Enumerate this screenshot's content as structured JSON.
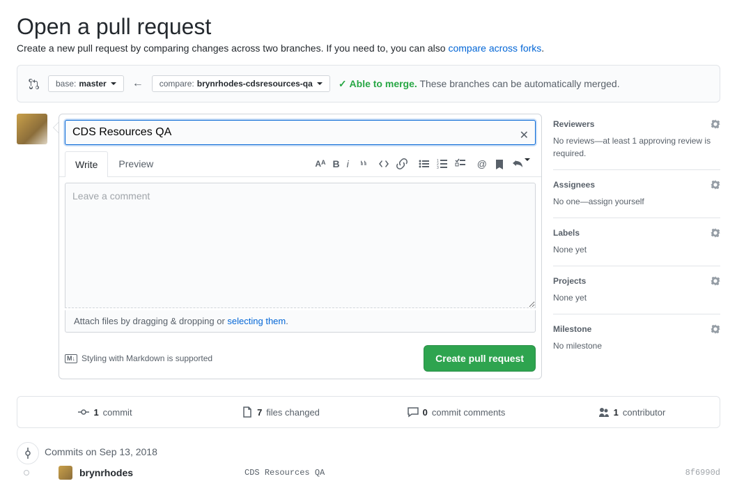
{
  "page": {
    "title": "Open a pull request",
    "subtitle_prefix": "Create a new pull request by comparing changes across two branches. If you need to, you can also ",
    "subtitle_link": "compare across forks",
    "subtitle_suffix": "."
  },
  "branches": {
    "base_label": "base:",
    "base_value": "master",
    "compare_label": "compare:",
    "compare_value": "brynrhodes-cdsresources-qa"
  },
  "merge": {
    "status": "Able to merge.",
    "description": "These branches can be automatically merged."
  },
  "pr": {
    "title_value": "CDS Resources QA",
    "comment_placeholder": "Leave a comment"
  },
  "tabs": {
    "write": "Write",
    "preview": "Preview"
  },
  "attach": {
    "prefix": "Attach files by dragging & dropping or ",
    "link": "selecting them",
    "suffix": "."
  },
  "footer": {
    "markdown_hint": "Styling with Markdown is supported",
    "create_label": "Create pull request"
  },
  "sidebar": {
    "reviewers": {
      "title": "Reviewers",
      "body": "No reviews—at least 1 approving review is required."
    },
    "assignees": {
      "title": "Assignees",
      "body_prefix": "No one—",
      "body_link": "assign yourself"
    },
    "labels": {
      "title": "Labels",
      "body": "None yet"
    },
    "projects": {
      "title": "Projects",
      "body": "None yet"
    },
    "milestone": {
      "title": "Milestone",
      "body": "No milestone"
    }
  },
  "stats": {
    "commits_count": "1",
    "commits_label": "commit",
    "files_count": "7",
    "files_label": "files changed",
    "comments_count": "0",
    "comments_label": "commit comments",
    "contributors_count": "1",
    "contributors_label": "contributor"
  },
  "timeline": {
    "date_label": "Commits on Sep 13, 2018",
    "commit": {
      "author": "brynrhodes",
      "message": "CDS Resources QA",
      "hash": "8f6990d"
    }
  }
}
